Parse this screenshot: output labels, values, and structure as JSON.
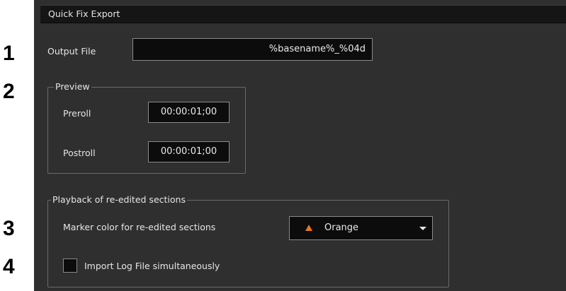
{
  "callouts": [
    "1",
    "2",
    "3",
    "4"
  ],
  "panel": {
    "title": "Quick Fix Export",
    "output_file": {
      "label": "Output File",
      "value": "%basename%_%04d"
    },
    "preview": {
      "legend": "Preview",
      "preroll": {
        "label": "Preroll",
        "value": "00:00:01;00"
      },
      "postroll": {
        "label": "Postroll",
        "value": "00:00:01;00"
      }
    },
    "playback": {
      "legend": "Playback of re-edited sections",
      "marker_color": {
        "label": "Marker color for re-edited sections",
        "selected": "Orange",
        "swatch_color": "#e8751a",
        "icon": "orange-triangle-icon"
      },
      "import_log": {
        "label": "Import Log File simultaneously",
        "checked": false
      }
    }
  }
}
